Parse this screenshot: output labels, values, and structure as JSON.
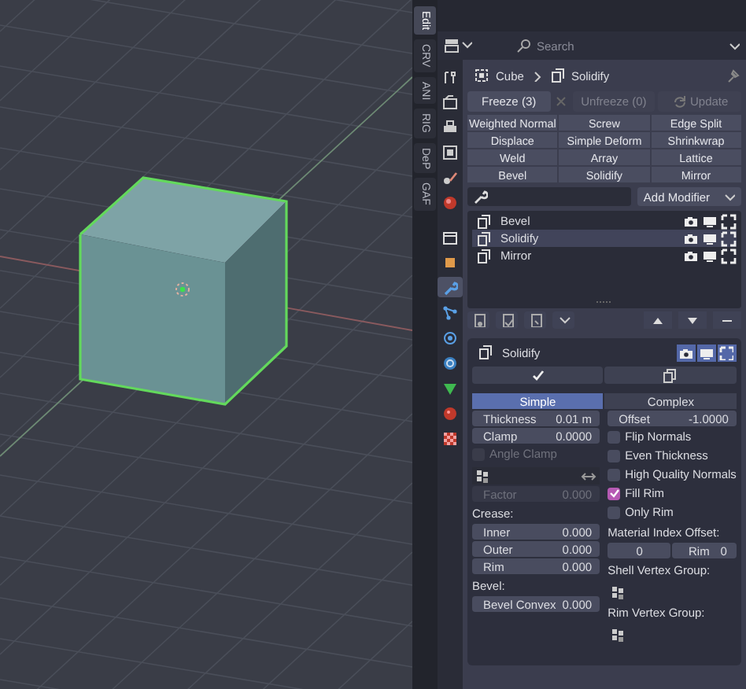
{
  "viewport": {
    "sidebar_tabs": [
      {
        "label": "Edit",
        "selected": true
      },
      {
        "label": "CRV",
        "selected": false
      },
      {
        "label": "ANI",
        "selected": false
      },
      {
        "label": "RIG",
        "selected": false
      },
      {
        "label": "DeP",
        "selected": false
      },
      {
        "label": "GAF",
        "selected": false
      }
    ]
  },
  "properties": {
    "search": {
      "placeholder": "Search"
    },
    "tabs": [
      {
        "kind": "tool",
        "selected": false
      },
      {
        "kind": "render",
        "selected": false
      },
      {
        "kind": "output",
        "selected": false
      },
      {
        "kind": "view_layer",
        "selected": false
      },
      {
        "kind": "scene",
        "selected": false
      },
      {
        "kind": "world",
        "selected": false
      },
      {
        "kind": "collection",
        "selected": false
      },
      {
        "kind": "object",
        "selected": false
      },
      {
        "kind": "modifiers",
        "selected": true
      },
      {
        "kind": "particles",
        "selected": false
      },
      {
        "kind": "physics",
        "selected": false
      },
      {
        "kind": "constraints",
        "selected": false
      },
      {
        "kind": "data",
        "selected": false
      },
      {
        "kind": "material",
        "selected": false
      },
      {
        "kind": "texture",
        "selected": false
      }
    ],
    "breadcrumb": [
      "Cube",
      "Solidify"
    ],
    "bake_buttons": [
      {
        "kind": "freeze",
        "label": "Freeze (3)",
        "disabled": false
      },
      {
        "kind": "unfreeze",
        "label": "Unfreeze (0)",
        "disabled": true
      },
      {
        "kind": "update",
        "label": "Update",
        "disabled": true
      }
    ],
    "modifier_buttons": [
      "Weighted Normal",
      "Screw",
      "Edge Split",
      "Displace",
      "Simple Deform",
      "Shrinkwrap",
      "Weld",
      "Array",
      "Lattice",
      "Bevel",
      "Solidify",
      "Mirror"
    ],
    "add_modifier": "Add Modifier",
    "modifiers": [
      {
        "name": "Bevel",
        "selected": false
      },
      {
        "name": "Solidify",
        "selected": true
      },
      {
        "name": "Mirror",
        "selected": false
      }
    ],
    "panel": {
      "title": "Solidify",
      "toggles": [
        {
          "kind": "render",
          "on": true
        },
        {
          "kind": "viewport",
          "on": true
        },
        {
          "kind": "editmode",
          "on": true
        }
      ],
      "modes": [
        {
          "label": "Simple",
          "selected": true
        },
        {
          "label": "Complex",
          "selected": false
        }
      ],
      "left": [
        {
          "kind": "field",
          "label": "Thickness",
          "value": "0.01 m",
          "disabled": false
        },
        {
          "kind": "field",
          "label": "Clamp",
          "value": "0.0000",
          "disabled": false
        },
        {
          "kind": "checkbox",
          "label": "Angle Clamp",
          "checked": false,
          "disabled": true
        },
        {
          "kind": "vgroup",
          "invert": true
        },
        {
          "kind": "field",
          "label": "Factor",
          "value": "0.000",
          "disabled": true
        },
        {
          "kind": "heading",
          "label": "Crease:"
        },
        {
          "kind": "field",
          "label": "Inner",
          "value": "0.000",
          "disabled": false
        },
        {
          "kind": "field",
          "label": "Outer",
          "value": "0.000",
          "disabled": false
        },
        {
          "kind": "field",
          "label": "Rim",
          "value": "0.000",
          "disabled": false
        },
        {
          "kind": "heading",
          "label": "Bevel:"
        },
        {
          "kind": "field",
          "label": "Bevel Convex",
          "value": "0.000",
          "disabled": false
        }
      ],
      "right": [
        {
          "kind": "field",
          "label": "Offset",
          "value": "-1.0000",
          "disabled": false
        },
        {
          "kind": "checkbox",
          "label": "Flip Normals",
          "checked": false,
          "disabled": false
        },
        {
          "kind": "checkbox",
          "label": "Even Thickness",
          "checked": false,
          "disabled": false
        },
        {
          "kind": "checkbox",
          "label": "High Quality Normals",
          "checked": false,
          "disabled": false
        },
        {
          "kind": "checkbox",
          "label": "Fill Rim",
          "checked": true,
          "disabled": false
        },
        {
          "kind": "checkbox",
          "label": "Only Rim",
          "checked": false,
          "disabled": false
        },
        {
          "kind": "heading",
          "label": "Material Index Offset:"
        },
        {
          "kind": "pair",
          "fields": [
            {
              "value": "0"
            },
            {
              "label": "Rim",
              "value": "0"
            }
          ]
        },
        {
          "kind": "heading",
          "label": "Shell Vertex Group:"
        },
        {
          "kind": "vgroup"
        },
        {
          "kind": "heading",
          "label": "Rim Vertex Group:"
        },
        {
          "kind": "vgroup"
        }
      ]
    }
  }
}
